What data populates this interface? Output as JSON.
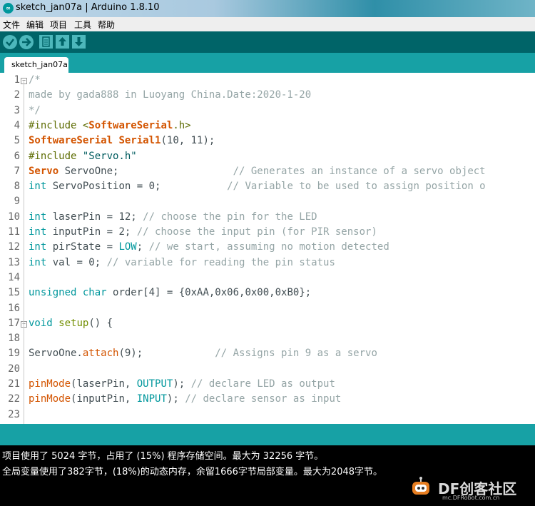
{
  "window": {
    "title": "sketch_jan07a | Arduino 1.8.10",
    "app_icon": "arduino-icon"
  },
  "menu": [
    "文件",
    "编辑",
    "项目",
    "工具",
    "帮助"
  ],
  "toolbar": {
    "buttons": [
      "verify-icon",
      "upload-icon",
      "new-icon",
      "open-icon",
      "save-icon"
    ],
    "accent": "#4db7bb",
    "background": "#006468"
  },
  "tab": {
    "label": "sketch_jan07a"
  },
  "editor": {
    "line_numbers": [
      "1",
      "2",
      "3",
      "4",
      "5",
      "6",
      "7",
      "8",
      "9",
      "10",
      "11",
      "12",
      "13",
      "14",
      "15",
      "16",
      "17",
      "18",
      "19",
      "20",
      "21",
      "22",
      "23"
    ],
    "lines": [
      [
        [
          "c",
          "/*"
        ]
      ],
      [
        [
          "c",
          "made by gada888 in Luoyang China.Date:2020-1-20"
        ]
      ],
      [
        [
          "c",
          "*/"
        ]
      ],
      [
        [
          "p",
          "#include <"
        ],
        [
          "cl",
          "SoftwareSerial"
        ],
        [
          "p",
          ".h>"
        ]
      ],
      [
        [
          "cl",
          "SoftwareSerial"
        ],
        [
          "n",
          " "
        ],
        [
          "cl",
          "Serial1"
        ],
        [
          "n",
          "(10, 11);"
        ]
      ],
      [
        [
          "p",
          "#include "
        ],
        [
          "s",
          "\"Servo.h\""
        ]
      ],
      [
        [
          "cl",
          "Servo"
        ],
        [
          "n",
          " ServoOne;                   "
        ],
        [
          "c",
          "// Generates an instance of a servo object"
        ]
      ],
      [
        [
          "t",
          "int"
        ],
        [
          "n",
          " ServoPosition = 0;           "
        ],
        [
          "c",
          "// Variable to be used to assign position o"
        ]
      ],
      [],
      [
        [
          "t",
          "int"
        ],
        [
          "n",
          " laserPin = 12; "
        ],
        [
          "c",
          "// choose the pin for the LED"
        ]
      ],
      [
        [
          "t",
          "int"
        ],
        [
          "n",
          " inputPin = 2; "
        ],
        [
          "c",
          "// choose the input pin (for PIR sensor)"
        ]
      ],
      [
        [
          "t",
          "int"
        ],
        [
          "n",
          " pirState = "
        ],
        [
          "k",
          "LOW"
        ],
        [
          "n",
          "; "
        ],
        [
          "c",
          "// we start, assuming no motion detected"
        ]
      ],
      [
        [
          "t",
          "int"
        ],
        [
          "n",
          " val = 0; "
        ],
        [
          "c",
          "// variable for reading the pin status"
        ]
      ],
      [],
      [
        [
          "t",
          "unsigned"
        ],
        [
          "n",
          " "
        ],
        [
          "t",
          "char"
        ],
        [
          "n",
          " order[4] = {0xAA,0x06,0x00,0xB0};"
        ]
      ],
      [],
      [
        [
          "t",
          "void"
        ],
        [
          "n",
          " "
        ],
        [
          "kw",
          "setup"
        ],
        [
          "n",
          "() {"
        ]
      ],
      [],
      [
        [
          "n",
          "ServoOne."
        ],
        [
          "f",
          "attach"
        ],
        [
          "n",
          "(9);            "
        ],
        [
          "c",
          "// Assigns pin 9 as a servo"
        ]
      ],
      [],
      [
        [
          "f",
          "pinMode"
        ],
        [
          "n",
          "(laserPin, "
        ],
        [
          "k",
          "OUTPUT"
        ],
        [
          "n",
          "); "
        ],
        [
          "c",
          "// declare LED as output"
        ]
      ],
      [
        [
          "f",
          "pinMode"
        ],
        [
          "n",
          "(inputPin, "
        ],
        [
          "k",
          "INPUT"
        ],
        [
          "n",
          "); "
        ],
        [
          "c",
          "// declare sensor as input"
        ]
      ],
      []
    ]
  },
  "console": {
    "lines": [
      "项目使用了 5024 字节，占用了 (15%) 程序存储空间。最大为 32256 字节。",
      "全局变量使用了382字节，(18%)的动态内存，余留1666字节局部变量。最大为2048字节。"
    ]
  },
  "watermark": {
    "text": "DF创客社区",
    "url": "mc.DFRobot.com.cn",
    "icon": "robot-logo-icon"
  }
}
